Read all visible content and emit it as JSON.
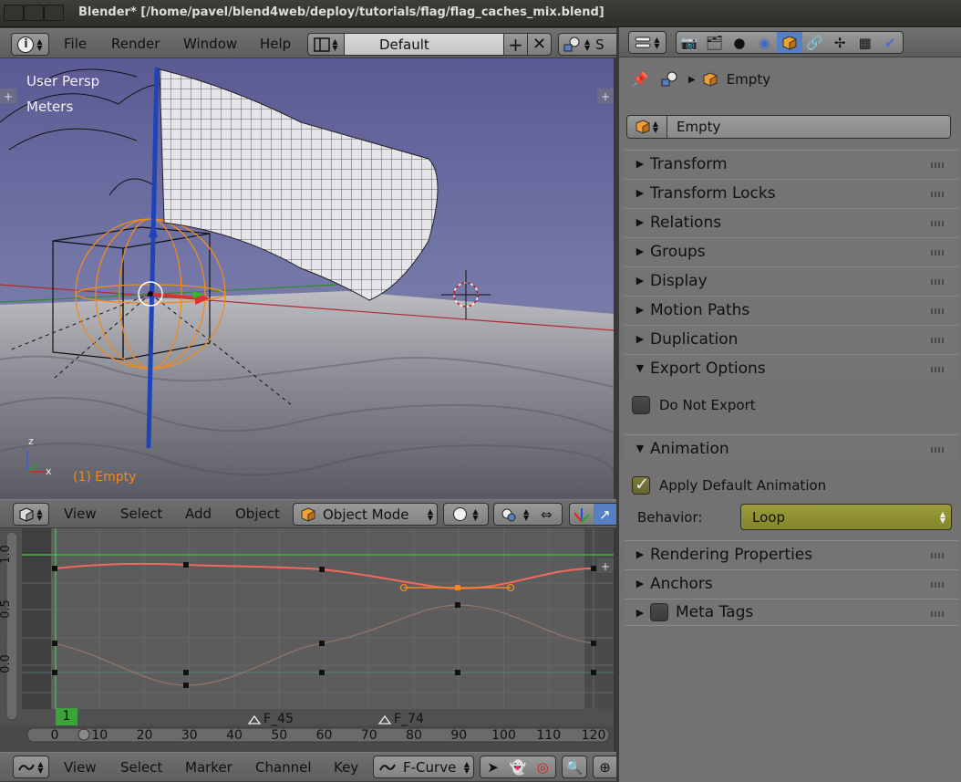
{
  "window": {
    "title": "Blender* [/home/pavel/blend4web/deploy/tutorials/flag/flag_caches_mix.blend]"
  },
  "info_header": {
    "menus": [
      "File",
      "Render",
      "Window",
      "Help"
    ],
    "screen_layout": "Default",
    "scene_partial": "S"
  },
  "viewport": {
    "view_label": "User Persp",
    "units_label": "Meters",
    "object_label": "(1) Empty",
    "axis_z": "z",
    "axis_x": "x"
  },
  "viewport_header": {
    "menus": [
      "View",
      "Select",
      "Add",
      "Object"
    ],
    "mode": "Object Mode"
  },
  "graph": {
    "y_ticks": [
      "1.0",
      "0.5",
      "0.0"
    ],
    "x_ticks": [
      "0",
      "10",
      "20",
      "30",
      "40",
      "50",
      "60",
      "70",
      "80",
      "90",
      "100",
      "110",
      "120"
    ],
    "current_frame": "1",
    "markers": [
      "F_45",
      "F_74"
    ]
  },
  "graph_header": {
    "menus": [
      "View",
      "Select",
      "Marker",
      "Channel",
      "Key"
    ],
    "mode": "F-Curve"
  },
  "properties": {
    "breadcrumb_object": "Empty",
    "object_name": "Empty",
    "panels": {
      "transform": "Transform",
      "transform_locks": "Transform Locks",
      "relations": "Relations",
      "groups": "Groups",
      "display": "Display",
      "motion_paths": "Motion Paths",
      "duplication": "Duplication",
      "export_options": "Export Options",
      "animation": "Animation",
      "rendering_properties": "Rendering Properties",
      "anchors": "Anchors",
      "meta_tags": "Meta Tags"
    },
    "do_not_export_label": "Do Not Export",
    "apply_default_animation_label": "Apply Default Animation",
    "behavior_label": "Behavior:",
    "behavior_value": "Loop"
  },
  "colors": {
    "accent_orange": "#f08a1e",
    "active_blue": "#5680c2",
    "loop_field": "#8f9031"
  }
}
